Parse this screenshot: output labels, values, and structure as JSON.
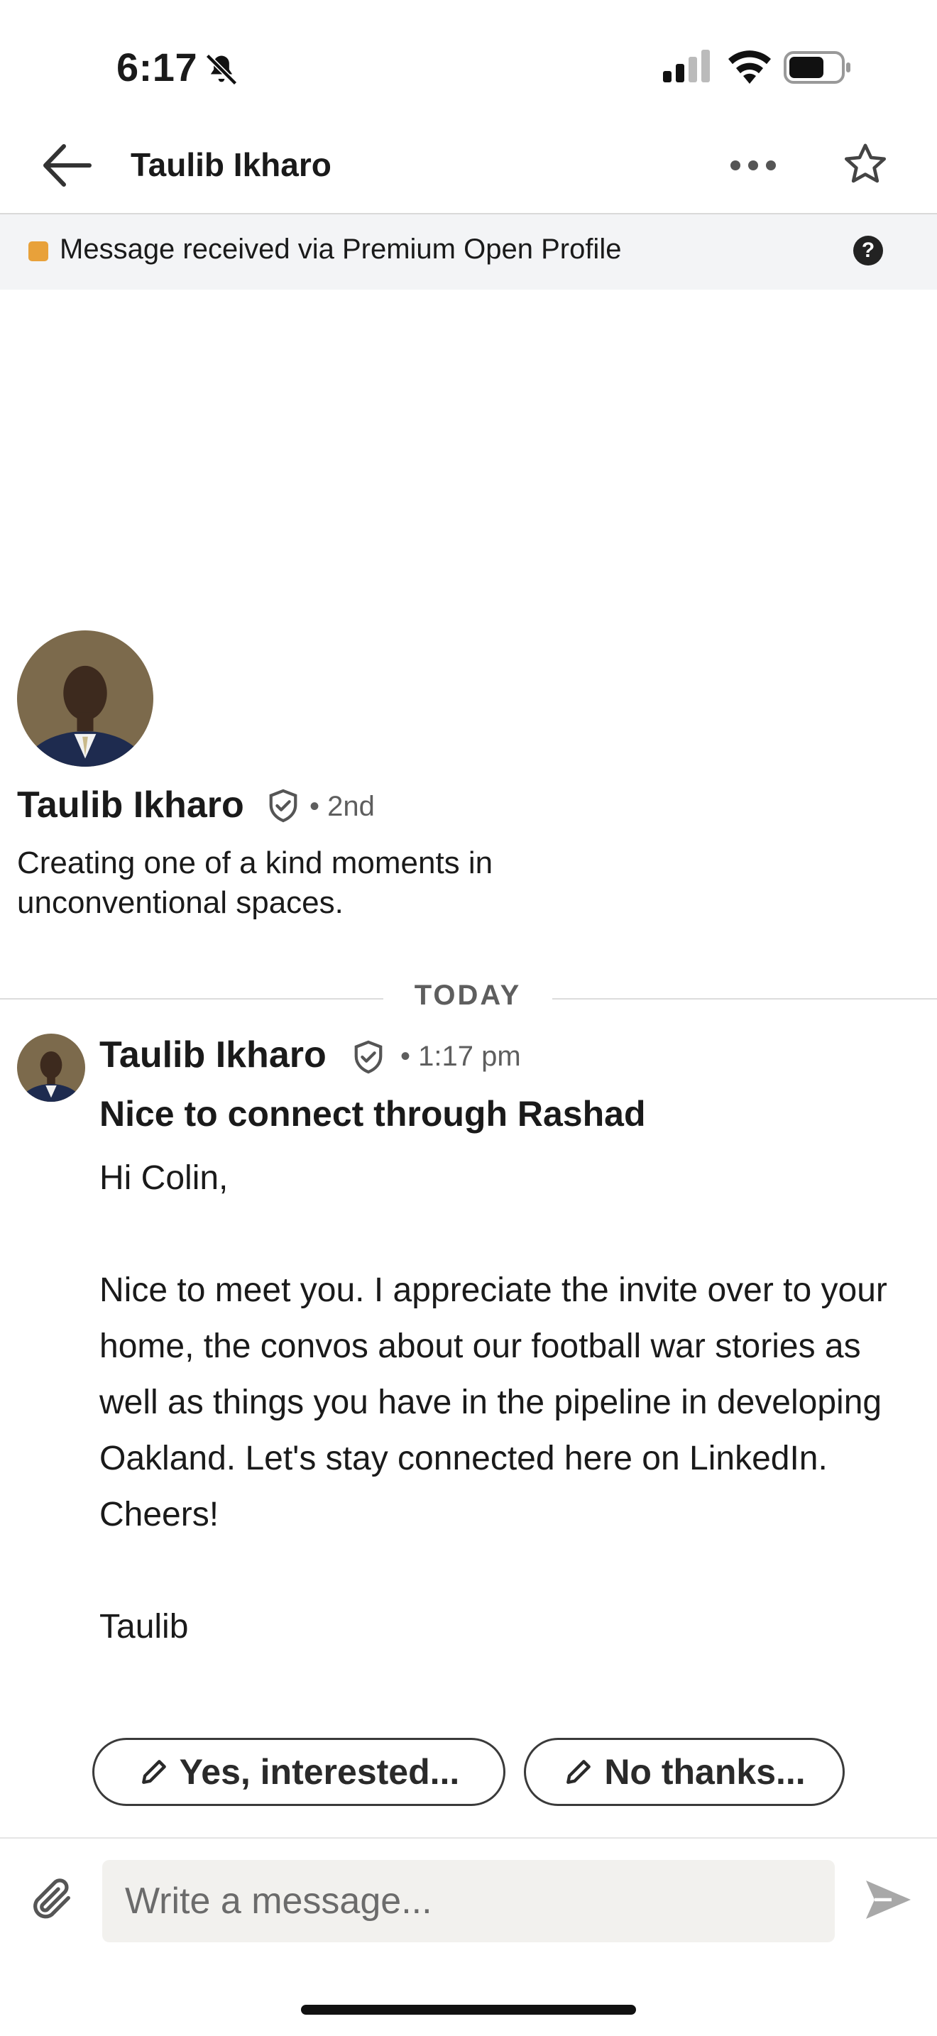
{
  "status_bar": {
    "time": "6:17"
  },
  "header": {
    "title": "Taulib Ikharo"
  },
  "banner": {
    "text": "Message received via Premium Open Profile",
    "help_glyph": "?"
  },
  "profile": {
    "name": "Taulib Ikharo",
    "degree": "• 2nd",
    "headline": "Creating one of a kind moments in unconventional spaces."
  },
  "divider": {
    "label": "TODAY"
  },
  "message": {
    "sender": "Taulib Ikharo",
    "time": "• 1:17 pm",
    "subject": "Nice to connect through Rashad",
    "body": "Hi Colin,\n\nNice to meet you. I appreciate the invite over to your home, the convos about our football war stories as well as things you have in the pipeline in developing Oakland. Let's stay connected here on LinkedIn. Cheers!\n\nTaulib"
  },
  "quick_replies": {
    "yes_label": "Yes, interested...",
    "no_label": "No thanks..."
  },
  "composer": {
    "placeholder": "Write a message..."
  },
  "colors": {
    "banner_bg": "#f3f4f6",
    "premium_badge": "#e8a13a",
    "input_bg": "#f2f1ee"
  }
}
